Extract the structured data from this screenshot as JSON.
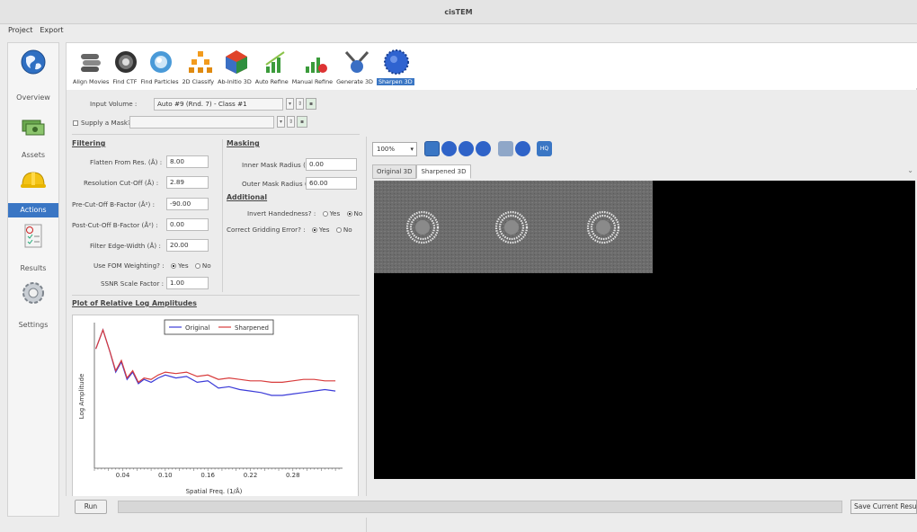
{
  "window": {
    "title": "cisTEM"
  },
  "menu": {
    "items": [
      "Project",
      "Export"
    ]
  },
  "nav": {
    "items": [
      {
        "label": "Overview",
        "icon": "overview-icon"
      },
      {
        "label": "Assets",
        "icon": "assets-icon"
      },
      {
        "label": "Actions",
        "icon": "actions-icon"
      },
      {
        "label": "Results",
        "icon": "results-icon"
      },
      {
        "label": "Settings",
        "icon": "settings-icon"
      }
    ],
    "selected": "Actions"
  },
  "toolbar": {
    "tools": [
      "Align Movies",
      "Find CTF",
      "Find Particles",
      "2D Classify",
      "Ab-Initio 3D",
      "Auto Refine",
      "Manual Refine",
      "Generate 3D",
      "Sharpen 3D"
    ],
    "active": "Sharpen 3D"
  },
  "inputs": {
    "input_volume_label": "Input Volume :",
    "input_volume_value": "Auto #9 (Rnd. 7) - Class #1",
    "supply_mask_label": "Supply a Mask? :"
  },
  "filtering": {
    "title": "Filtering",
    "fields": [
      {
        "label": "Flatten From Res. (Å) :",
        "value": "8.00"
      },
      {
        "label": "Resolution Cut-Off (Å) :",
        "value": "2.89"
      },
      {
        "label": "Pre-Cut-Off B-Factor (Å²) :",
        "value": "-90.00"
      },
      {
        "label": "Post-Cut-Off B-Factor (Å²) :",
        "value": "0.00"
      },
      {
        "label": "Filter Edge-Width (Å) :",
        "value": "20.00"
      }
    ],
    "fom_label": "Use FOM Weighting? :",
    "ssnr_label": "SSNR Scale Factor :",
    "ssnr_value": "1.00"
  },
  "masking": {
    "title": "Masking",
    "inner_label": "Inner Mask Radius (Å) :",
    "inner_value": "0.00",
    "outer_label": "Outer Mask Radius (Å) :",
    "outer_value": "60.00"
  },
  "additional": {
    "title": "Additional",
    "invert_label": "Invert Handedness? :",
    "gridding_label": "Correct Gridding Error? :"
  },
  "radio": {
    "yes": "Yes",
    "no": "No"
  },
  "plot": {
    "section_title": "Plot of Relative Log Amplitudes"
  },
  "chart_data": {
    "type": "line",
    "title": "",
    "xlabel": "Spatial Freq. (1/Å)",
    "ylabel": "Log Amplitude",
    "xlim": [
      0.0,
      0.35
    ],
    "x_ticks": [
      "0.04",
      "0.10",
      "0.16",
      "0.22",
      "0.28"
    ],
    "legend_position": "top-right",
    "series": [
      {
        "name": "Original",
        "color": "#3b3bd8",
        "x": [
          0.002,
          0.012,
          0.022,
          0.03,
          0.038,
          0.046,
          0.054,
          0.062,
          0.07,
          0.08,
          0.09,
          0.1,
          0.115,
          0.13,
          0.145,
          0.16,
          0.175,
          0.19,
          0.205,
          0.22,
          0.235,
          0.25,
          0.265,
          0.28,
          0.295,
          0.31,
          0.325,
          0.34
        ],
        "y": [
          0.82,
          0.95,
          0.8,
          0.66,
          0.73,
          0.61,
          0.66,
          0.58,
          0.61,
          0.59,
          0.62,
          0.64,
          0.62,
          0.63,
          0.59,
          0.6,
          0.55,
          0.56,
          0.54,
          0.53,
          0.52,
          0.5,
          0.5,
          0.51,
          0.52,
          0.53,
          0.54,
          0.53
        ]
      },
      {
        "name": "Sharpened",
        "color": "#d83b3b",
        "x": [
          0.002,
          0.012,
          0.022,
          0.03,
          0.038,
          0.046,
          0.054,
          0.062,
          0.07,
          0.08,
          0.09,
          0.1,
          0.115,
          0.13,
          0.145,
          0.16,
          0.175,
          0.19,
          0.205,
          0.22,
          0.235,
          0.25,
          0.265,
          0.28,
          0.295,
          0.31,
          0.325,
          0.34
        ],
        "y": [
          0.82,
          0.95,
          0.8,
          0.67,
          0.74,
          0.62,
          0.67,
          0.59,
          0.62,
          0.61,
          0.64,
          0.66,
          0.65,
          0.66,
          0.63,
          0.64,
          0.61,
          0.62,
          0.61,
          0.6,
          0.6,
          0.59,
          0.59,
          0.6,
          0.61,
          0.61,
          0.6,
          0.6
        ]
      }
    ]
  },
  "viewer": {
    "zoom": "100%",
    "tabs": [
      "Original 3D",
      "Sharpened 3D"
    ],
    "active_tab": "Sharpened 3D"
  },
  "bottom": {
    "run_label": "Run",
    "save_label": "Save Current Result"
  },
  "colors": {
    "accent": "#3a76c4"
  }
}
